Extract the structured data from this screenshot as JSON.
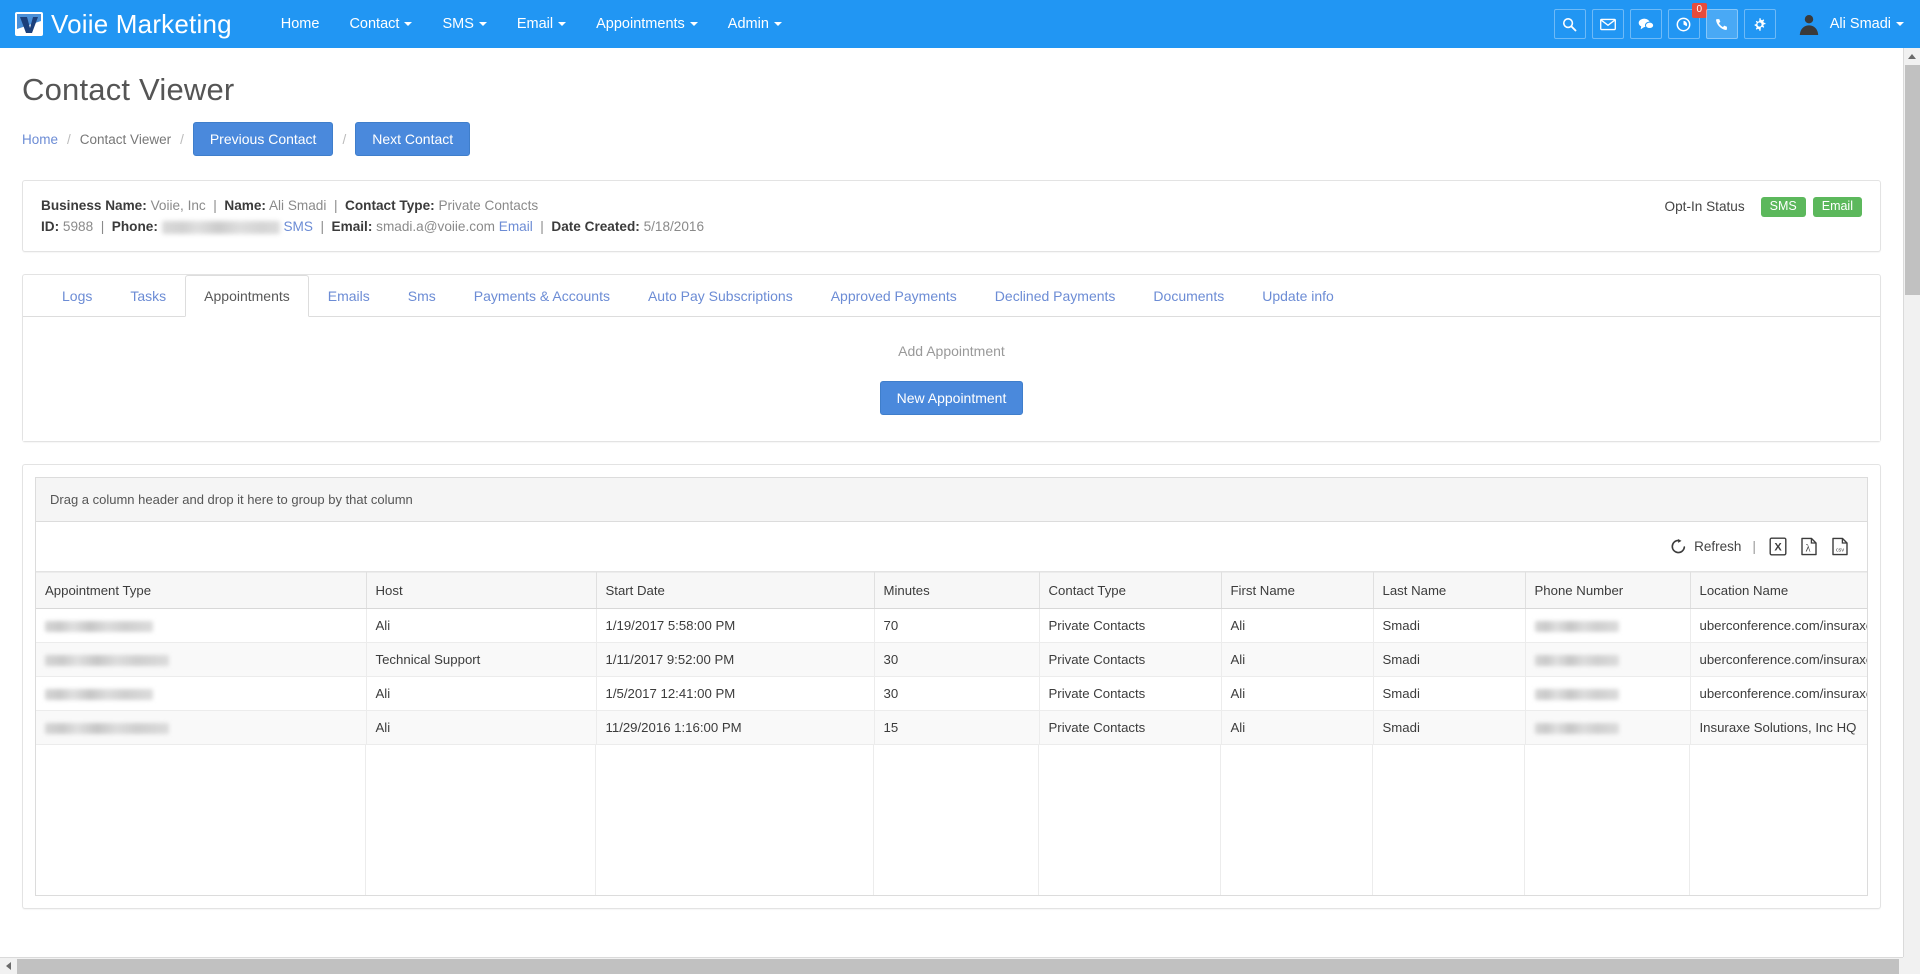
{
  "navbar": {
    "brand": "Voiie Marketing",
    "links": [
      {
        "label": "Home",
        "has_caret": false
      },
      {
        "label": "Contact",
        "has_caret": true
      },
      {
        "label": "SMS",
        "has_caret": true
      },
      {
        "label": "Email",
        "has_caret": true
      },
      {
        "label": "Appointments",
        "has_caret": true
      },
      {
        "label": "Admin",
        "has_caret": true
      }
    ],
    "icons": [
      {
        "name": "search-icon",
        "badge": null
      },
      {
        "name": "envelope-icon",
        "badge": null
      },
      {
        "name": "chat-bubble-icon",
        "badge": null
      },
      {
        "name": "clock-icon",
        "badge": "0"
      },
      {
        "name": "phone-icon",
        "badge": null
      },
      {
        "name": "gear-icon",
        "badge": null
      }
    ],
    "user_name": "Ali Smadi",
    "brand_color": "#2196f3"
  },
  "page": {
    "title": "Contact Viewer"
  },
  "breadcrumb": {
    "home": "Home",
    "current": "Contact Viewer",
    "separator": "/",
    "previous_button": "Previous Contact",
    "next_button": "Next Contact"
  },
  "contact": {
    "line1": {
      "business_name_label": "Business Name:",
      "business_name_value": "Voiie, Inc",
      "name_label": "Name:",
      "name_value": "Ali Smadi",
      "contact_type_label": "Contact Type:",
      "contact_type_value": "Private Contacts"
    },
    "line2": {
      "id_label": "ID:",
      "id_value": "5988",
      "phone_label": "Phone:",
      "phone_value": "",
      "sms_link": "SMS",
      "email_label": "Email",
      "email_value": "smadi.a@voiie.com",
      "email_link": "Email",
      "date_created_label": "Date Created:",
      "date_created_value": "5/18/2016"
    },
    "optin": {
      "label": "Opt-In Status",
      "badges": [
        {
          "text": "SMS",
          "color": "#5cb85c"
        },
        {
          "text": "Email",
          "color": "#5cb85c"
        }
      ]
    }
  },
  "tabs": [
    {
      "label": "Logs",
      "active": false
    },
    {
      "label": "Tasks",
      "active": false
    },
    {
      "label": "Appointments",
      "active": true
    },
    {
      "label": "Emails",
      "active": false
    },
    {
      "label": "Sms",
      "active": false
    },
    {
      "label": "Payments & Accounts",
      "active": false
    },
    {
      "label": "Auto Pay Subscriptions",
      "active": false
    },
    {
      "label": "Approved Payments",
      "active": false
    },
    {
      "label": "Declined Payments",
      "active": false
    },
    {
      "label": "Documents",
      "active": false
    },
    {
      "label": "Update info",
      "active": false
    }
  ],
  "appointments_panel": {
    "add_label": "Add Appointment",
    "new_button": "New Appointment"
  },
  "grid": {
    "group_panel_text": "Drag a column header and drop it here to group by that column",
    "toolbar": {
      "refresh_label": "Refresh",
      "separator": "|",
      "export_excel": "export-excel-icon",
      "export_pdf": "export-pdf-icon",
      "export_csv": "export-csv-icon"
    },
    "columns": [
      "Appointment Type",
      "Host",
      "Start Date",
      "Minutes",
      "Contact Type",
      "First Name",
      "Last Name",
      "Phone Number",
      "Location Name"
    ],
    "rows": [
      {
        "appointment_type": "",
        "host": "Ali",
        "start_date": "1/19/2017 5:58:00 PM",
        "minutes": "70",
        "contact_type": "Private Contacts",
        "first_name": "Ali",
        "last_name": "Smadi",
        "phone_number": "",
        "location_name": "uberconference.com/insuraxe"
      },
      {
        "appointment_type": "",
        "host": "Technical Support",
        "start_date": "1/11/2017 9:52:00 PM",
        "minutes": "30",
        "contact_type": "Private Contacts",
        "first_name": "Ali",
        "last_name": "Smadi",
        "phone_number": "",
        "location_name": "uberconference.com/insuraxe"
      },
      {
        "appointment_type": "",
        "host": "Ali",
        "start_date": "1/5/2017 12:41:00 PM",
        "minutes": "30",
        "contact_type": "Private Contacts",
        "first_name": "Ali",
        "last_name": "Smadi",
        "phone_number": "",
        "location_name": "uberconference.com/insuraxe"
      },
      {
        "appointment_type": "",
        "host": "Ali",
        "start_date": "11/29/2016 1:16:00 PM",
        "minutes": "15",
        "contact_type": "Private Contacts",
        "first_name": "Ali",
        "last_name": "Smadi",
        "phone_number": "",
        "location_name": "Insuraxe Solutions, Inc HQ"
      }
    ]
  }
}
